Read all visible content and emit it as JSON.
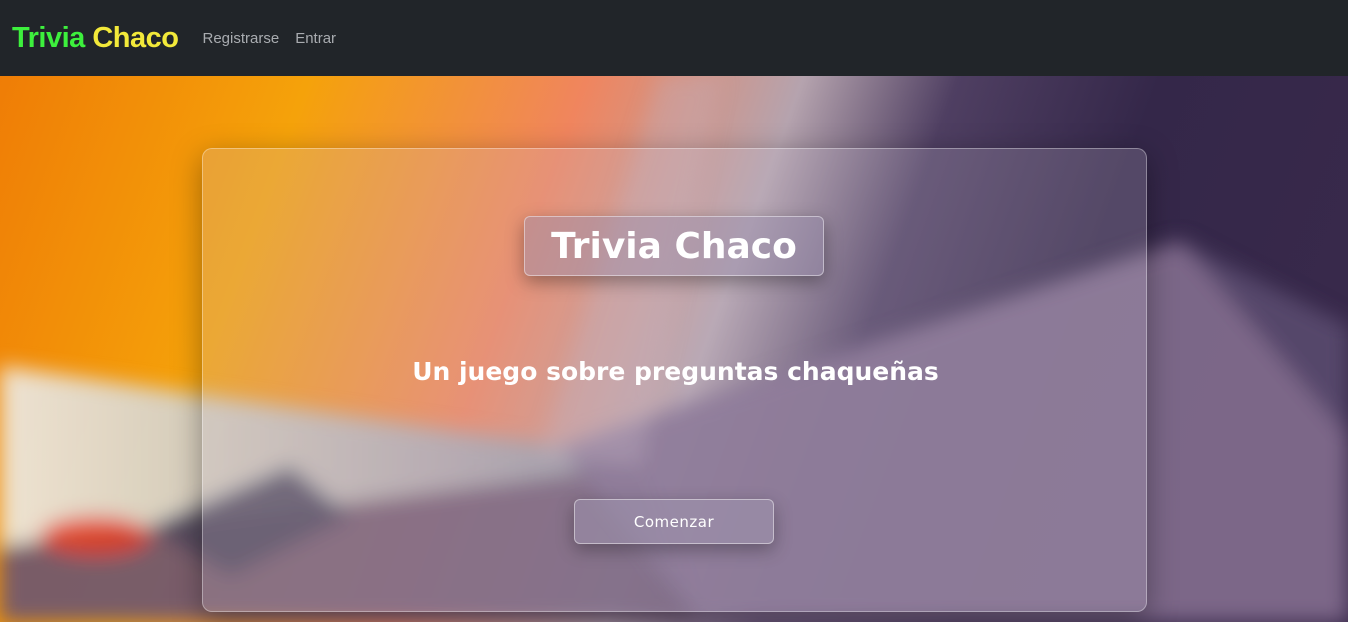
{
  "navbar": {
    "brand_part1": "Trivia",
    "brand_part2": "Chaco",
    "links": [
      {
        "label": "Registrarse"
      },
      {
        "label": "Entrar"
      }
    ]
  },
  "hero": {
    "title": "Trivia Chaco",
    "subtitle": "Un juego sobre preguntas chaqueñas",
    "start_button": "Comenzar"
  },
  "colors": {
    "navbar_bg": "#212529",
    "brand_green": "#3df03d",
    "brand_yellow": "#f2e93a",
    "nav_link": "#a9acb0"
  }
}
